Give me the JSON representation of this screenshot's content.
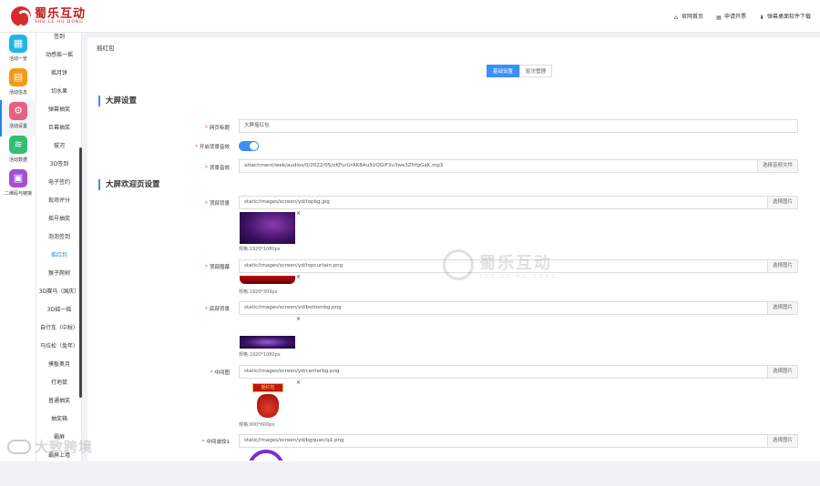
{
  "header": {
    "logo_cn": "蜀乐互动",
    "logo_en": "SHU LE HU DONG",
    "links": [
      {
        "icon": "home-icon",
        "label": "官网首页"
      },
      {
        "icon": "document-icon",
        "label": "申请开票"
      },
      {
        "icon": "download-icon",
        "label": "弹幕桌面软件下载"
      }
    ]
  },
  "sidebar_primary": [
    {
      "icon": "grid-icon",
      "color": "#22b6e8",
      "label": "活动一览"
    },
    {
      "icon": "file-icon",
      "color": "#f39c12",
      "label": "活动信息"
    },
    {
      "icon": "gear-icon",
      "color": "#e75f85",
      "label": "活动设置",
      "active": true
    },
    {
      "icon": "database-icon",
      "color": "#2fbf71",
      "label": "活动数据"
    },
    {
      "icon": "qrcode-icon",
      "color": "#a34fd6",
      "label": "二维码与链接"
    }
  ],
  "sidebar_secondary": [
    "签到",
    "动感摇一摇",
    "摇月饼",
    "切水果",
    "弹幕抽奖",
    "巨幕抽奖",
    "拔河",
    "3D签到",
    "电子签约",
    "现场评分",
    "摇号抽奖",
    "泡泡签到",
    "摇红包",
    "猴子爬树",
    "3D赛马（国庆）",
    "3D摇一摇",
    "自行车（中秋）",
    "马拉松（兔年）",
    "摸板奥月",
    "打地鼠",
    "普通抽奖",
    "抽奖箱",
    "霸屏",
    "霸屏上墙"
  ],
  "sidebar_secondary_active": 12,
  "breadcrumb": "摇红包",
  "tabs": [
    "基础设置",
    "轮次管理"
  ],
  "sections": {
    "big_screen": "大屏设置",
    "welcome": "大屏欢迎页设置"
  },
  "fields": {
    "page_title": {
      "label": "网页标题",
      "value": "大屏摇红包"
    },
    "bgm_toggle": {
      "label": "开启背景音效"
    },
    "bgm": {
      "label": "背景音效",
      "value": "attachment/web/audios/0/2022/05/oKFurUrAK8Au3UQGiF3u3we3ZfrfgGaK.mp3",
      "button": "选择音频文件"
    },
    "top_bg": {
      "label": "顶部背景",
      "value": "static/images/screen/yd/topbg.jpg",
      "button": "选择图片",
      "hint": "规格:1920*1080px"
    },
    "top_curtain": {
      "label": "顶部围幕",
      "value": "static/images/screen/yd/topcurtain.png",
      "button": "选择图片",
      "hint": "规格:1920*309px"
    },
    "bottom_bg": {
      "label": "底部背景",
      "value": "static/images/screen/yd/bottombg.png",
      "button": "选择图片",
      "hint": "规格:1920*1080px"
    },
    "center_img": {
      "label": "中间图",
      "value": "static/images/screen/yd/centerbg.png",
      "button": "选择图片",
      "hint": "规格:900*600px",
      "image_text": "摇红包"
    },
    "center_ring": {
      "label": "中间波纹1",
      "value": "static/images/screen/yd/bgquan/q1.png",
      "button": "选择图片"
    }
  },
  "watermark": {
    "cn": "蜀乐互动",
    "en": "SHU LE HU DONG"
  },
  "corner_watermark": "大致跨境"
}
